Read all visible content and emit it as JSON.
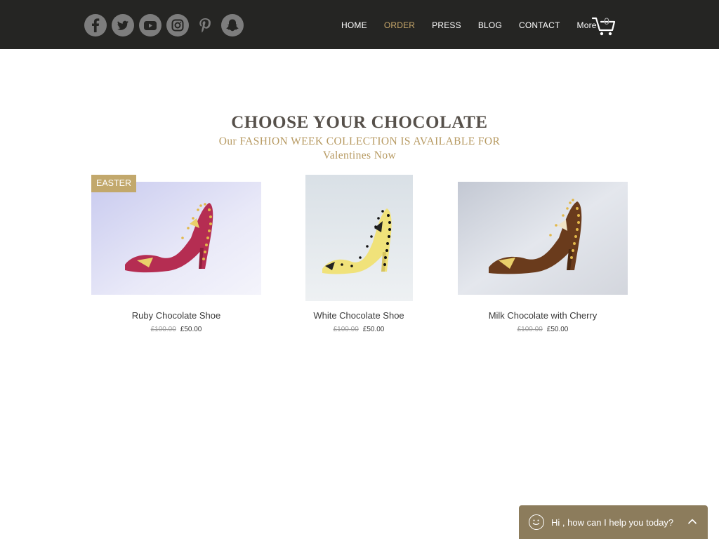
{
  "header": {
    "socials": [
      {
        "name": "facebook",
        "icon": "facebook-icon"
      },
      {
        "name": "twitter",
        "icon": "twitter-icon"
      },
      {
        "name": "youtube",
        "icon": "youtube-icon"
      },
      {
        "name": "instagram",
        "icon": "instagram-icon"
      },
      {
        "name": "pinterest",
        "icon": "pinterest-icon"
      },
      {
        "name": "snapchat",
        "icon": "snapchat-icon"
      }
    ],
    "nav": [
      {
        "label": "HOME",
        "active": false
      },
      {
        "label": "ORDER",
        "active": true
      },
      {
        "label": "PRESS",
        "active": false
      },
      {
        "label": "BLOG",
        "active": false
      },
      {
        "label": "CONTACT",
        "active": false
      },
      {
        "label": "More",
        "active": false
      }
    ],
    "cart_count": "0"
  },
  "main": {
    "title": "CHOOSE YOUR CHOCOLATE",
    "subtitle_line1": "Our FASHION WEEK COLLECTION IS AVAILABLE FOR",
    "subtitle_line2": "Valentines Now"
  },
  "products": [
    {
      "name": "Ruby Chocolate Shoe",
      "old_price": "£100.00",
      "price": "£50.00",
      "ribbon": "EASTER",
      "color": "#b52d52"
    },
    {
      "name": "White Chocolate Shoe",
      "old_price": "£100.00",
      "price": "£50.00",
      "color": "#f0e27a"
    },
    {
      "name": "Milk Chocolate with Cherry",
      "old_price": "£100.00",
      "price": "£50.00",
      "color": "#6a3b1c"
    }
  ],
  "chat": {
    "message": "Hi , how can I help you today?",
    "icon": "smiley-icon"
  },
  "colors": {
    "header_bg": "#252523",
    "accent_gold": "#c7a76a",
    "chat_bg": "#8c7c5c"
  }
}
